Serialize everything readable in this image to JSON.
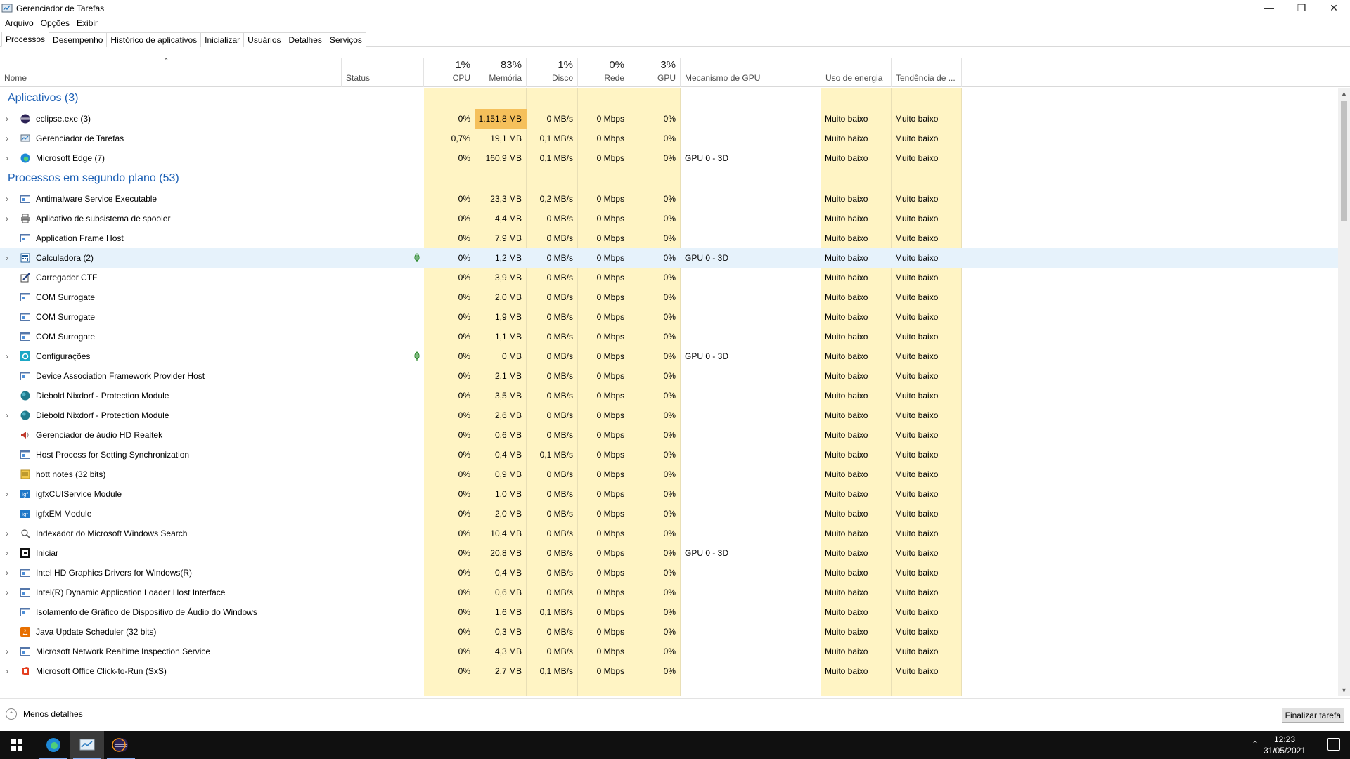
{
  "window": {
    "title": "Gerenciador de Tarefas"
  },
  "menu": [
    "Arquivo",
    "Opções",
    "Exibir"
  ],
  "tabs": [
    "Processos",
    "Desempenho",
    "Histórico de aplicativos",
    "Inicializar",
    "Usuários",
    "Detalhes",
    "Serviços"
  ],
  "columns": {
    "name": "Nome",
    "status": "Status",
    "cpu": {
      "pct": "1%",
      "label": "CPU"
    },
    "mem": {
      "pct": "83%",
      "label": "Memória"
    },
    "disk": {
      "pct": "1%",
      "label": "Disco"
    },
    "net": {
      "pct": "0%",
      "label": "Rede"
    },
    "gpu": {
      "pct": "3%",
      "label": "GPU"
    },
    "gpu_engine": "Mecanismo de GPU",
    "power": "Uso de energia",
    "power_trend": "Tendência de ..."
  },
  "groups": [
    {
      "title": "Aplicativos (3)",
      "rows": [
        {
          "name": "eclipse.exe (3)",
          "icon": "eclipse-icon",
          "expand": true,
          "cpu": "0%",
          "mem": "1.151,8 MB",
          "disk": "0 MB/s",
          "net": "0 Mbps",
          "gpu": "0%",
          "engine": "",
          "power": "Muito baixo",
          "trend": "Muito baixo",
          "memhot": true
        },
        {
          "name": "Gerenciador de Tarefas",
          "icon": "taskmgr-icon",
          "expand": true,
          "cpu": "0,7%",
          "mem": "19,1 MB",
          "disk": "0,1 MB/s",
          "net": "0 Mbps",
          "gpu": "0%",
          "engine": "",
          "power": "Muito baixo",
          "trend": "Muito baixo"
        },
        {
          "name": "Microsoft Edge (7)",
          "icon": "edge-icon",
          "expand": true,
          "cpu": "0%",
          "mem": "160,9 MB",
          "disk": "0,1 MB/s",
          "net": "0 Mbps",
          "gpu": "0%",
          "engine": "GPU 0 - 3D",
          "power": "Muito baixo",
          "trend": "Muito baixo"
        }
      ]
    },
    {
      "title": "Processos em segundo plano (53)",
      "rows": [
        {
          "name": "Antimalware Service Executable",
          "icon": "app-window-icon",
          "expand": true,
          "cpu": "0%",
          "mem": "23,3 MB",
          "disk": "0,2 MB/s",
          "net": "0 Mbps",
          "gpu": "0%",
          "engine": "",
          "power": "Muito baixo",
          "trend": "Muito baixo"
        },
        {
          "name": "Aplicativo de subsistema de spooler",
          "icon": "printer-icon",
          "expand": true,
          "cpu": "0%",
          "mem": "4,4 MB",
          "disk": "0 MB/s",
          "net": "0 Mbps",
          "gpu": "0%",
          "engine": "",
          "power": "Muito baixo",
          "trend": "Muito baixo"
        },
        {
          "name": "Application Frame Host",
          "icon": "app-window-icon",
          "expand": false,
          "cpu": "0%",
          "mem": "7,9 MB",
          "disk": "0 MB/s",
          "net": "0 Mbps",
          "gpu": "0%",
          "engine": "",
          "power": "Muito baixo",
          "trend": "Muito baixo"
        },
        {
          "name": "Calculadora (2)",
          "icon": "calculator-icon",
          "expand": true,
          "cpu": "0%",
          "mem": "1,2 MB",
          "disk": "0 MB/s",
          "net": "0 Mbps",
          "gpu": "0%",
          "engine": "GPU 0 - 3D",
          "power": "Muito baixo",
          "trend": "Muito baixo",
          "selected": true,
          "leaf": true
        },
        {
          "name": "Carregador CTF",
          "icon": "ctf-pen-icon",
          "expand": false,
          "cpu": "0%",
          "mem": "3,9 MB",
          "disk": "0 MB/s",
          "net": "0 Mbps",
          "gpu": "0%",
          "engine": "",
          "power": "Muito baixo",
          "trend": "Muito baixo"
        },
        {
          "name": "COM Surrogate",
          "icon": "app-window-icon",
          "expand": false,
          "cpu": "0%",
          "mem": "2,0 MB",
          "disk": "0 MB/s",
          "net": "0 Mbps",
          "gpu": "0%",
          "engine": "",
          "power": "Muito baixo",
          "trend": "Muito baixo"
        },
        {
          "name": "COM Surrogate",
          "icon": "app-window-icon",
          "expand": false,
          "cpu": "0%",
          "mem": "1,9 MB",
          "disk": "0 MB/s",
          "net": "0 Mbps",
          "gpu": "0%",
          "engine": "",
          "power": "Muito baixo",
          "trend": "Muito baixo"
        },
        {
          "name": "COM Surrogate",
          "icon": "app-window-icon",
          "expand": false,
          "cpu": "0%",
          "mem": "1,1 MB",
          "disk": "0 MB/s",
          "net": "0 Mbps",
          "gpu": "0%",
          "engine": "",
          "power": "Muito baixo",
          "trend": "Muito baixo"
        },
        {
          "name": "Configurações",
          "icon": "settings-gear-icon",
          "expand": true,
          "cpu": "0%",
          "mem": "0 MB",
          "disk": "0 MB/s",
          "net": "0 Mbps",
          "gpu": "0%",
          "engine": "GPU 0 - 3D",
          "power": "Muito baixo",
          "trend": "Muito baixo",
          "leaf": true
        },
        {
          "name": "Device Association Framework Provider Host",
          "icon": "app-window-icon",
          "expand": false,
          "cpu": "0%",
          "mem": "2,1 MB",
          "disk": "0 MB/s",
          "net": "0 Mbps",
          "gpu": "0%",
          "engine": "",
          "power": "Muito baixo",
          "trend": "Muito baixo"
        },
        {
          "name": "Diebold Nixdorf - Protection Module",
          "icon": "globe-icon",
          "expand": false,
          "cpu": "0%",
          "mem": "3,5 MB",
          "disk": "0 MB/s",
          "net": "0 Mbps",
          "gpu": "0%",
          "engine": "",
          "power": "Muito baixo",
          "trend": "Muito baixo"
        },
        {
          "name": "Diebold Nixdorf - Protection Module",
          "icon": "globe-icon",
          "expand": true,
          "cpu": "0%",
          "mem": "2,6 MB",
          "disk": "0 MB/s",
          "net": "0 Mbps",
          "gpu": "0%",
          "engine": "",
          "power": "Muito baixo",
          "trend": "Muito baixo"
        },
        {
          "name": "Gerenciador de áudio HD Realtek",
          "icon": "speaker-icon",
          "expand": false,
          "cpu": "0%",
          "mem": "0,6 MB",
          "disk": "0 MB/s",
          "net": "0 Mbps",
          "gpu": "0%",
          "engine": "",
          "power": "Muito baixo",
          "trend": "Muito baixo"
        },
        {
          "name": "Host Process for Setting Synchronization",
          "icon": "app-window-icon",
          "expand": false,
          "cpu": "0%",
          "mem": "0,4 MB",
          "disk": "0,1 MB/s",
          "net": "0 Mbps",
          "gpu": "0%",
          "engine": "",
          "power": "Muito baixo",
          "trend": "Muito baixo"
        },
        {
          "name": "hott notes (32 bits)",
          "icon": "notes-icon",
          "expand": false,
          "cpu": "0%",
          "mem": "0,9 MB",
          "disk": "0 MB/s",
          "net": "0 Mbps",
          "gpu": "0%",
          "engine": "",
          "power": "Muito baixo",
          "trend": "Muito baixo"
        },
        {
          "name": "igfxCUIService Module",
          "icon": "intel-icon",
          "expand": true,
          "cpu": "0%",
          "mem": "1,0 MB",
          "disk": "0 MB/s",
          "net": "0 Mbps",
          "gpu": "0%",
          "engine": "",
          "power": "Muito baixo",
          "trend": "Muito baixo"
        },
        {
          "name": "igfxEM Module",
          "icon": "intel-icon",
          "expand": false,
          "cpu": "0%",
          "mem": "2,0 MB",
          "disk": "0 MB/s",
          "net": "0 Mbps",
          "gpu": "0%",
          "engine": "",
          "power": "Muito baixo",
          "trend": "Muito baixo"
        },
        {
          "name": "Indexador do Microsoft Windows Search",
          "icon": "search-person-icon",
          "expand": true,
          "cpu": "0%",
          "mem": "10,4 MB",
          "disk": "0 MB/s",
          "net": "0 Mbps",
          "gpu": "0%",
          "engine": "",
          "power": "Muito baixo",
          "trend": "Muito baixo"
        },
        {
          "name": "Iniciar",
          "icon": "start-window-icon",
          "expand": true,
          "cpu": "0%",
          "mem": "20,8 MB",
          "disk": "0 MB/s",
          "net": "0 Mbps",
          "gpu": "0%",
          "engine": "GPU 0 - 3D",
          "power": "Muito baixo",
          "trend": "Muito baixo"
        },
        {
          "name": "Intel HD Graphics Drivers for Windows(R)",
          "icon": "app-window-icon",
          "expand": true,
          "cpu": "0%",
          "mem": "0,4 MB",
          "disk": "0 MB/s",
          "net": "0 Mbps",
          "gpu": "0%",
          "engine": "",
          "power": "Muito baixo",
          "trend": "Muito baixo"
        },
        {
          "name": "Intel(R) Dynamic Application Loader Host Interface",
          "icon": "app-window-icon",
          "expand": true,
          "cpu": "0%",
          "mem": "0,6 MB",
          "disk": "0 MB/s",
          "net": "0 Mbps",
          "gpu": "0%",
          "engine": "",
          "power": "Muito baixo",
          "trend": "Muito baixo"
        },
        {
          "name": "Isolamento de Gráfico de Dispositivo de Áudio do Windows",
          "icon": "app-window-icon",
          "expand": false,
          "cpu": "0%",
          "mem": "1,6 MB",
          "disk": "0,1 MB/s",
          "net": "0 Mbps",
          "gpu": "0%",
          "engine": "",
          "power": "Muito baixo",
          "trend": "Muito baixo"
        },
        {
          "name": "Java Update Scheduler (32 bits)",
          "icon": "java-icon",
          "expand": false,
          "cpu": "0%",
          "mem": "0,3 MB",
          "disk": "0 MB/s",
          "net": "0 Mbps",
          "gpu": "0%",
          "engine": "",
          "power": "Muito baixo",
          "trend": "Muito baixo"
        },
        {
          "name": "Microsoft Network Realtime Inspection Service",
          "icon": "app-window-icon",
          "expand": true,
          "cpu": "0%",
          "mem": "4,3 MB",
          "disk": "0 MB/s",
          "net": "0 Mbps",
          "gpu": "0%",
          "engine": "",
          "power": "Muito baixo",
          "trend": "Muito baixo"
        },
        {
          "name": "Microsoft Office Click-to-Run (SxS)",
          "icon": "office-icon",
          "expand": true,
          "cpu": "0%",
          "mem": "2,7 MB",
          "disk": "0,1 MB/s",
          "net": "0 Mbps",
          "gpu": "0%",
          "engine": "",
          "power": "Muito baixo",
          "trend": "Muito baixo"
        }
      ]
    }
  ],
  "footer": {
    "less_details": "Menos detalhes",
    "end_task": "Finalizar tarefa"
  },
  "taskbar": {
    "time": "12:23",
    "date": "31/05/2021"
  },
  "colors": {
    "heat": "#fff4c4",
    "memhot": "#f5c05b",
    "group_title": "#1b5fb4",
    "selection": "#e6f2fb"
  }
}
